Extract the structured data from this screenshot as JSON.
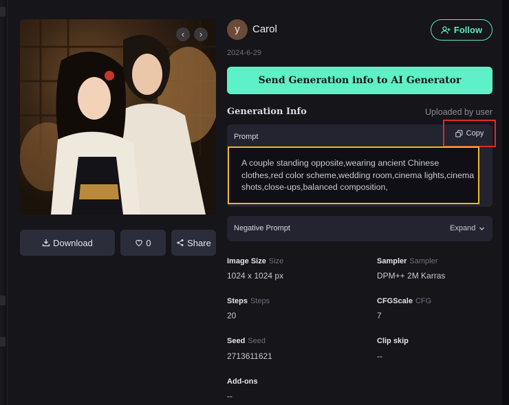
{
  "image": {
    "prev_icon": "chevron-left-icon",
    "next_icon": "chevron-right-icon",
    "prev_glyph": "‹",
    "next_glyph": "›"
  },
  "actions": {
    "download_label": "Download",
    "like_count": "0",
    "share_label": "Share"
  },
  "user": {
    "avatar_letter": "y",
    "name": "Carol",
    "date": "2024-6-29",
    "follow_label": "Follow"
  },
  "send_button_label": "Send Generation info to AI Generator",
  "generation": {
    "title": "Generation Info",
    "uploaded": "Uploaded by user",
    "prompt_label": "Prompt",
    "copy_label": "Copy",
    "prompt_text": "A couple standing opposite,wearing ancient Chinese clothes,red color scheme,wedding room,cinema lights,cinema shots,close-ups,balanced composition,",
    "negative_label": "Negative Prompt",
    "expand_label": "Expand"
  },
  "fields": {
    "image_size": {
      "label": "Image Size",
      "sub": "Size",
      "value": "1024 x 1024 px"
    },
    "sampler": {
      "label": "Sampler",
      "sub": "Sampler",
      "value": "DPM++ 2M Karras"
    },
    "steps": {
      "label": "Steps",
      "sub": "Steps",
      "value": "20"
    },
    "cfg": {
      "label": "CFGScale",
      "sub": "CFG",
      "value": "7"
    },
    "seed": {
      "label": "Seed",
      "sub": "Seed",
      "value": "2713611621"
    },
    "clip_skip": {
      "label": "Clip skip",
      "sub": "",
      "value": "--"
    },
    "addons": {
      "label": "Add-ons",
      "sub": "",
      "value": "--"
    }
  },
  "colors": {
    "accent": "#5ef0c6",
    "copy_highlight": "#e02b2b",
    "prompt_highlight": "#f1b726"
  }
}
